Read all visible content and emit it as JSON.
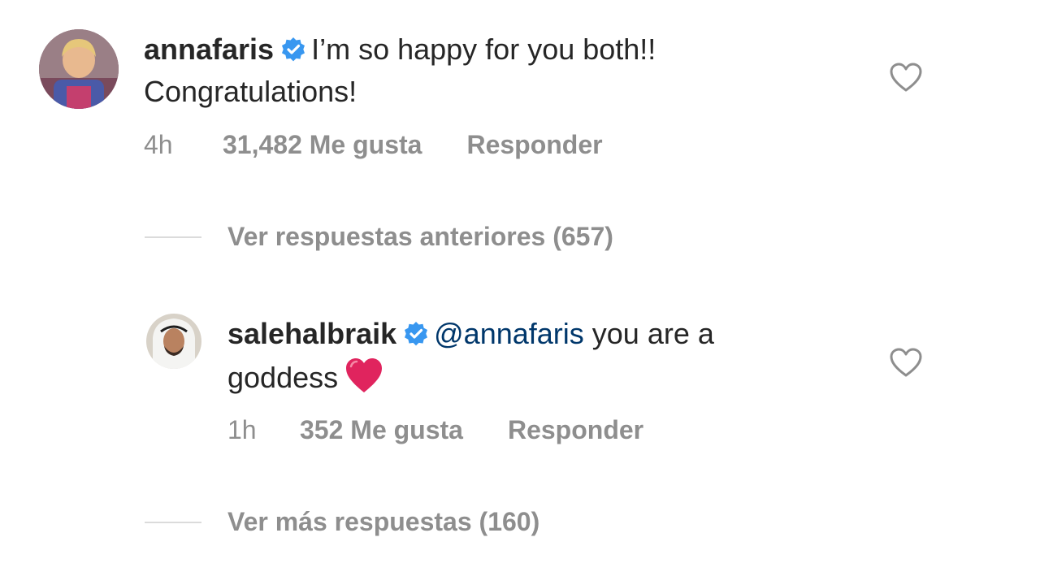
{
  "comments": [
    {
      "username": "annafaris",
      "text_line1": "I’m so happy for you both!!",
      "text_line2": "Congratulations!",
      "time": "4h",
      "likes": "31,482 Me gusta",
      "reply_label": "Responder"
    }
  ],
  "previous_replies_label": "Ver respuestas anteriores (657)",
  "reply": {
    "username": "salehalbraik",
    "mention": "@annafaris",
    "text_part1": " you are a",
    "text_part2": "goddess",
    "time": "1h",
    "likes": "352 Me gusta",
    "reply_label": "Responder"
  },
  "more_replies_label": "Ver más respuestas (160)",
  "colors": {
    "verified": "#3897f0",
    "mention": "#00376b",
    "meta": "#8e8e8e",
    "heart_emoji": "#e0245e"
  },
  "icons": [
    "verified-badge-icon",
    "heart-outline-icon",
    "red-heart-emoji-icon"
  ]
}
